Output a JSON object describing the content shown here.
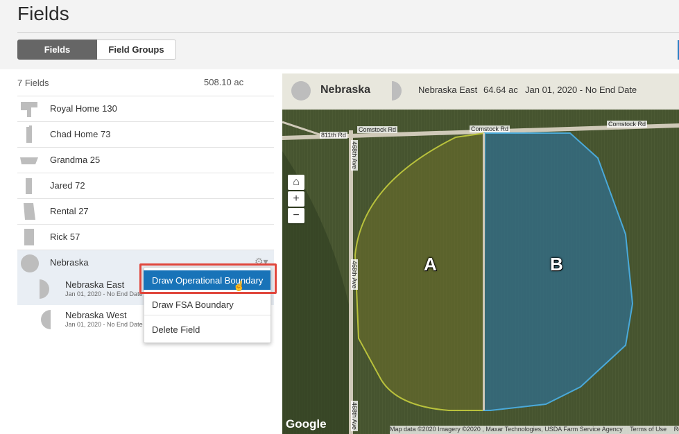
{
  "page": {
    "title": "Fields"
  },
  "tabs": [
    {
      "label": "Fields",
      "active": true
    },
    {
      "label": "Field Groups",
      "active": false
    }
  ],
  "list": {
    "count_label": "7 Fields",
    "total_area": "508.10 ac",
    "fields": [
      {
        "name": "Royal Home 130"
      },
      {
        "name": "Chad Home 73"
      },
      {
        "name": "Grandma 25"
      },
      {
        "name": "Jared 72"
      },
      {
        "name": "Rental 27"
      },
      {
        "name": "Rick 57"
      },
      {
        "name": "Nebraska"
      }
    ],
    "subfields": [
      {
        "name": "Nebraska East",
        "date": "Jan 01, 2020 - No End Date"
      },
      {
        "name": "Nebraska West",
        "date": "Jan 01, 2020 - No End Date"
      }
    ]
  },
  "context_menu": {
    "items": [
      "Draw Operational Boundary",
      "Draw FSA Boundary",
      "Delete Field"
    ]
  },
  "map": {
    "header": {
      "field": "Nebraska",
      "subfield": "Nebraska East",
      "acres": "64.64 ac",
      "date": "Jan 01, 2020 - No End Date"
    },
    "roads": {
      "h1": "811th Rd",
      "h2": "Comstock Rd",
      "h3": "Comstock Rd",
      "h4": "Comstock Rd",
      "v1": "468th Ave",
      "v2": "468th Ave",
      "v3": "468th Ave"
    },
    "labels": {
      "a": "A",
      "b": "B"
    },
    "controls": {
      "home": "⌂",
      "zoom_in": "+",
      "zoom_out": "−"
    },
    "google": "Google",
    "attribution": {
      "data": "Map data ©2020 Imagery ©2020 , Maxar Technologies, USDA Farm Service Agency",
      "terms": "Terms of Use",
      "report": "Re"
    },
    "colors": {
      "boundary_a": "#b9c23c",
      "boundary_b": "#4aa9d9",
      "fill_b": "#2f6f93"
    }
  }
}
